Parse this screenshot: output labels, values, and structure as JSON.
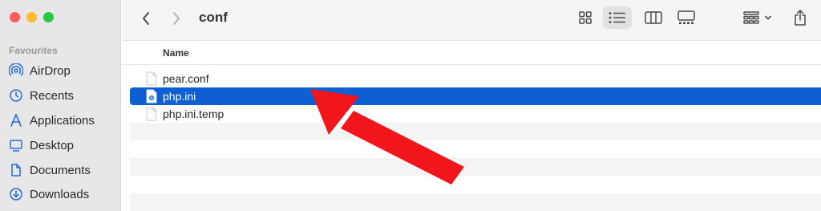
{
  "window": {
    "title": "conf"
  },
  "sidebar": {
    "section_title": "Favourites",
    "items": [
      {
        "label": "AirDrop",
        "icon": "airdrop-icon"
      },
      {
        "label": "Recents",
        "icon": "clock-icon"
      },
      {
        "label": "Applications",
        "icon": "applications-icon"
      },
      {
        "label": "Desktop",
        "icon": "desktop-icon"
      },
      {
        "label": "Documents",
        "icon": "document-icon"
      },
      {
        "label": "Downloads",
        "icon": "download-icon"
      }
    ]
  },
  "list": {
    "column_name": "Name",
    "files": [
      {
        "name": "pear.conf",
        "selected": false
      },
      {
        "name": "php.ini",
        "selected": true
      },
      {
        "name": "php.ini.temp",
        "selected": false
      }
    ]
  },
  "colors": {
    "accent": "#0d5fd3",
    "sidebar_icon": "#1f6fd6",
    "arrow": "#f0161b",
    "close": "#fe5f57",
    "minimize": "#febc2e",
    "zoom": "#28c840"
  }
}
